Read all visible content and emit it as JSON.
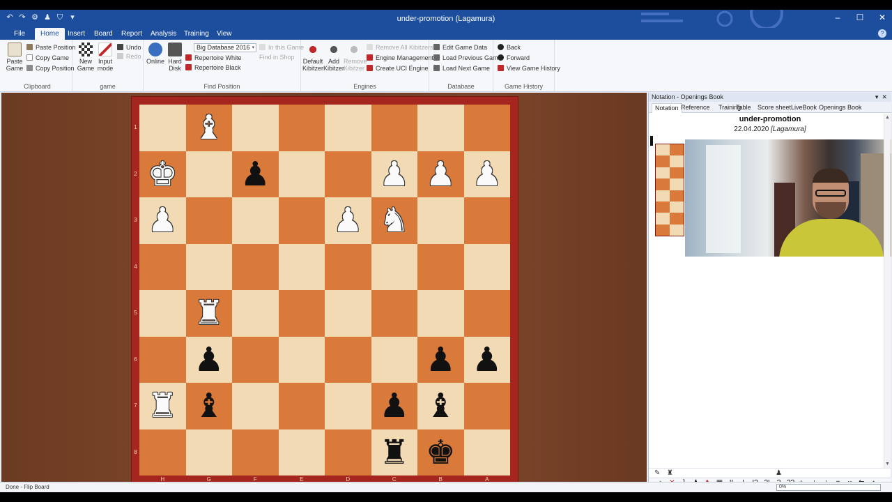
{
  "window": {
    "title": "under-promotion  (Lagamura)"
  },
  "ribbon_tabs": [
    "File",
    "Home",
    "Insert",
    "Board",
    "Report",
    "Analysis",
    "Training",
    "View"
  ],
  "ribbon": {
    "clipboard": {
      "label": "Clipboard",
      "paste_game": "Paste Game",
      "paste_position": "Paste Position",
      "copy_game": "Copy Game",
      "copy_position": "Copy Position"
    },
    "game": {
      "label": "game",
      "new_game": "New Game",
      "input_mode": "Input mode",
      "undo": "Undo",
      "redo": "Redo"
    },
    "find_position": {
      "label": "Find Position",
      "online": "Online",
      "hard_disk": "Hard Disk",
      "database": "Big Database 2016",
      "repertoire_white": "Repertoire White",
      "repertoire_black": "Repertoire Black",
      "in_this_game": "In this Game",
      "find_in_shop": "Find in Shop"
    },
    "engines": {
      "label": "Engines",
      "default_kibitzer": "Default Kibitzer",
      "add_kibitzer": "Add Kibitzer",
      "remove_kibitzer": "Remove Kibitzer",
      "remove_all_kibitzers": "Remove All Kibitzers",
      "engine_management": "Engine Management",
      "create_uci_engine": "Create UCI Engine"
    },
    "database": {
      "label": "Database",
      "edit_game_data": "Edit Game Data",
      "load_previous_game": "Load Previous Game",
      "load_next_game": "Load Next Game"
    },
    "game_history": {
      "label": "Game History",
      "back": "Back",
      "forward": "Forward",
      "view_game_history": "View Game History"
    }
  },
  "board": {
    "ranks": [
      "1",
      "2",
      "3",
      "4",
      "5",
      "6",
      "7",
      "8"
    ],
    "files": [
      "H",
      "G",
      "F",
      "E",
      "D",
      "C",
      "B",
      "A"
    ],
    "pieces": [
      [
        "",
        "wB",
        "",
        "",
        "",
        "",
        "",
        ""
      ],
      [
        "wK",
        "",
        "bP",
        "",
        "",
        "wP",
        "wP",
        "wP"
      ],
      [
        "wP",
        "",
        "",
        "",
        "wP",
        "wN",
        "",
        ""
      ],
      [
        "",
        "",
        "",
        "",
        "",
        "",
        "",
        ""
      ],
      [
        "",
        "wR",
        "",
        "",
        "",
        "",
        "",
        ""
      ],
      [
        "",
        "bP",
        "",
        "",
        "",
        "",
        "bP",
        "bP"
      ],
      [
        "wR",
        "bB",
        "",
        "",
        "",
        "bP",
        "bB",
        ""
      ],
      [
        "",
        "",
        "",
        "",
        "",
        "bR",
        "bK",
        ""
      ]
    ]
  },
  "panel": {
    "header": "Notation - Openings Book",
    "tabs": [
      "Notation",
      "Reference",
      "Training",
      "Table",
      "Score sheet",
      "LiveBook",
      "Openings Book"
    ],
    "game_title": "under-promotion",
    "game_date": "22.04.2020",
    "game_site": "[Lagamura]",
    "annotation_symbols": [
      "!!",
      "!",
      "!?",
      "?!",
      "?",
      "??",
      "+-",
      "±",
      "±",
      "=",
      "∞",
      "⇆",
      "↑"
    ]
  },
  "status": {
    "text": "Done - Flip Board",
    "progress": "0%"
  }
}
